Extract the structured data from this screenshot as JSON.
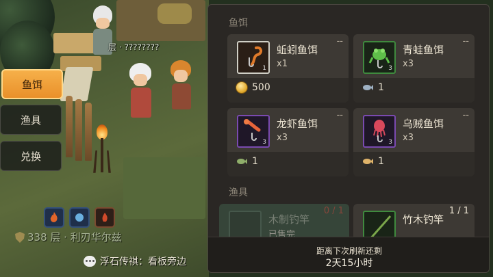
{
  "scene": {
    "player_name": "层 · ????????",
    "floor_info": "338 层 · 利刃华尔兹",
    "chat_text": "浮石传祺：看板旁边"
  },
  "side_tabs": [
    {
      "label": "鱼饵",
      "active": true
    },
    {
      "label": "渔具",
      "active": false
    },
    {
      "label": "兑换",
      "active": false
    }
  ],
  "shop": {
    "section_bait": "鱼饵",
    "section_gear": "渔具",
    "items": [
      {
        "name": "蚯蚓鱼饵",
        "count": "x1",
        "thumb_qty": "1",
        "limit": "--",
        "price": "500",
        "currency_icon": "gold-coin-icon"
      },
      {
        "name": "青蛙鱼饵",
        "count": "x3",
        "thumb_qty": "3",
        "limit": "--",
        "price": "1",
        "currency_icon": "fish-token-icon"
      },
      {
        "name": "龙虾鱼饵",
        "count": "x3",
        "thumb_qty": "3",
        "limit": "--",
        "price": "1",
        "currency_icon": "green-fish-token-icon"
      },
      {
        "name": "乌贼鱼饵",
        "count": "x3",
        "thumb_qty": "3",
        "limit": "--",
        "price": "1",
        "currency_icon": "golden-fish-token-icon"
      }
    ],
    "gear": [
      {
        "name": "木制钓竿",
        "limit": "0 / 1",
        "sub": "已售完"
      },
      {
        "name": "竹木钓竿",
        "limit": "1 / 1"
      }
    ],
    "refresh_label": "距离下次刷新还剩",
    "refresh_time": "2天15小时"
  },
  "colors": {
    "accent_tab": "#f6b04a",
    "panel_bg": "#2a2724",
    "card_bg": "#3d3934"
  }
}
